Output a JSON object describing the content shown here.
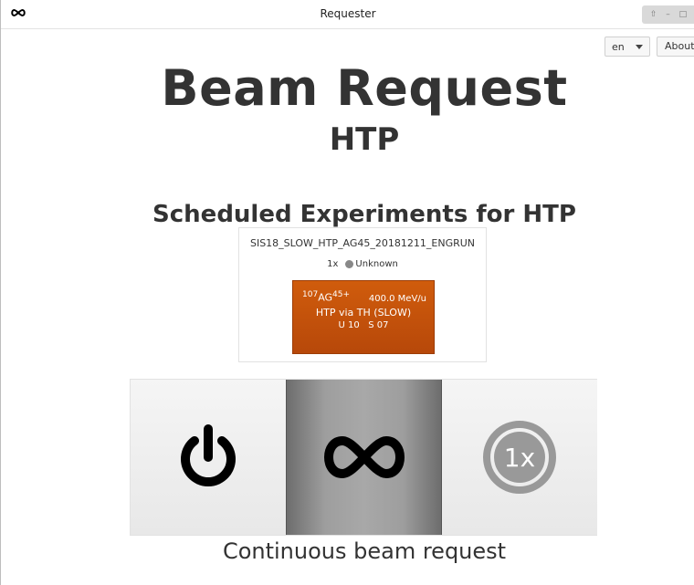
{
  "window": {
    "title": "Requester",
    "app_icon": "infinity-icon",
    "controls": [
      "up-icon",
      "minimize-icon",
      "maximize-icon"
    ]
  },
  "toolbar": {
    "language": "en",
    "about_label": "About"
  },
  "header": {
    "title": "Beam Request",
    "subtitle": "HTP"
  },
  "schedule": {
    "title": "Scheduled Experiments for HTP",
    "experiments": [
      {
        "name": "SIS18_SLOW_HTP_AG45_20181211_ENGRUN",
        "multiplier": "1x",
        "status": "Unknown",
        "status_color": "#888888",
        "beam": {
          "mass_number": "107",
          "element": "AG",
          "charge": "45+",
          "energy": "400.0 MeV/u",
          "path": "HTP via TH (SLOW)",
          "u_label": "U 10",
          "s_label": "S 07",
          "color": "#c4520b"
        }
      }
    ]
  },
  "modes": {
    "items": [
      {
        "name": "power",
        "icon": "power-icon",
        "selected": false
      },
      {
        "name": "continuous",
        "icon": "infinity-icon",
        "selected": true
      },
      {
        "name": "once",
        "icon": "1x",
        "selected": false
      }
    ],
    "once_label": "1x",
    "caption": "Continuous beam request"
  }
}
